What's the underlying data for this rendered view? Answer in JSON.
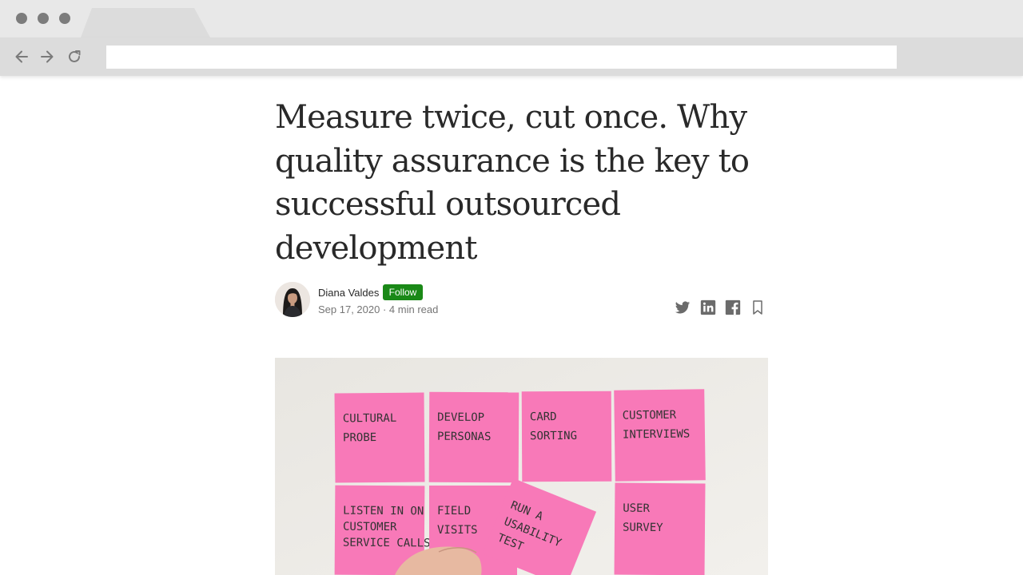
{
  "browser": {
    "url": "",
    "icons": [
      "back-arrow-icon",
      "forward-arrow-icon",
      "reload-icon"
    ]
  },
  "article": {
    "title": "Measure twice, cut once. Why quality assurance is the key to successful outsourced development",
    "author": "Diana Valdes",
    "follow_label": "Follow",
    "date": "Sep 17, 2020",
    "separator": " · ",
    "read_time": "4 min read",
    "share_icons": [
      "twitter-icon",
      "linkedin-icon",
      "facebook-icon",
      "bookmark-icon"
    ],
    "colors": {
      "follow_bg": "#1a8917",
      "title": "#292929",
      "meta": "#757575"
    }
  },
  "hero_image": {
    "notes": [
      {
        "lines": [
          "CULTURAL",
          "PROBE"
        ]
      },
      {
        "lines": [
          "DEVELOP",
          "PERSONAS"
        ]
      },
      {
        "lines": [
          "CARD",
          "SORTING"
        ]
      },
      {
        "lines": [
          "CUSTOMER",
          "INTERVIEWS"
        ]
      },
      {
        "lines": [
          "LISTEN IN ON",
          "CUSTOMER",
          "SERVICE CALLS"
        ]
      },
      {
        "lines": [
          "FIELD",
          "VISITS"
        ]
      },
      {
        "lines": [
          "USER",
          "SURVEY"
        ]
      },
      {
        "lines": [
          "RUN A",
          "USABILITY",
          "TEST"
        ]
      }
    ],
    "note_color": "#f879b8"
  }
}
